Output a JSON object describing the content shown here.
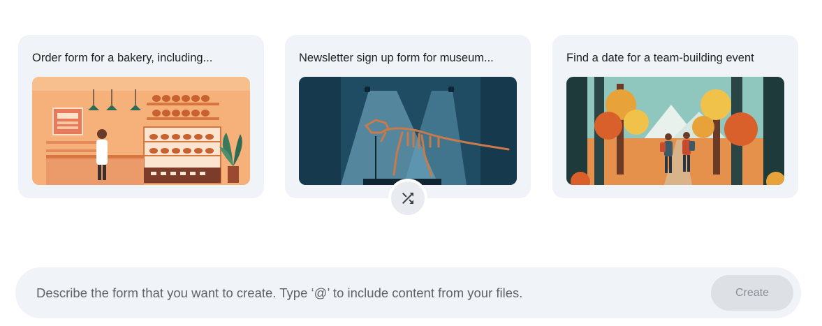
{
  "suggestions": [
    {
      "title": "Order form for a bakery, including...",
      "image": "bakery-illustration"
    },
    {
      "title": "Newsletter sign up form for museum...",
      "image": "museum-dinosaur-illustration"
    },
    {
      "title": "Find a date for a team-building event",
      "image": "forest-hike-illustration"
    }
  ],
  "shuffle": {
    "icon": "shuffle-icon"
  },
  "prompt": {
    "placeholder": "Describe the form that you want to create. Type ‘@’ to include content from your files.",
    "value": "",
    "create_label": "Create"
  },
  "colors": {
    "card_bg": "#f0f4f9",
    "create_disabled_bg": "#dde1e6",
    "create_disabled_text": "#8a8f95"
  }
}
